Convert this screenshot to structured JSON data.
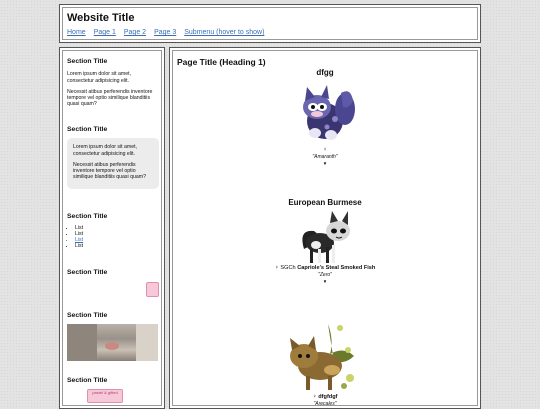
{
  "header": {
    "title": "Website Title",
    "nav": [
      "Home",
      "Page 1",
      "Page 2",
      "Page 3",
      "Submenu (hover to show)"
    ]
  },
  "sidebar": {
    "sections": [
      {
        "title": "Section Title",
        "p1": "Lorem ipsum dolor sit amet, consectetur adipisicing elit.",
        "p2": "Necessit atibus perferendis inventore tempore vel optio similique blanditiis quasi quam?"
      },
      {
        "title": "Section Title",
        "p1": "Lorem ipsum dolor sit amet, consectetur adipisicing elit.",
        "p2": "Necessit atibus perferendis inventore tempore vel optio similique blanditiis quasi quam?"
      },
      {
        "title": "Section Title",
        "list": [
          "List",
          "List",
          "List",
          "List"
        ]
      },
      {
        "title": "Section Title"
      },
      {
        "title": "Section Title"
      },
      {
        "title": "Section Title",
        "sticker": "pastel & gifted"
      }
    ]
  },
  "main": {
    "page_title": "Page Title (Heading 1)",
    "pets": [
      {
        "name": "dfgg",
        "gender": "♀",
        "prefix": "",
        "fullname": "",
        "nickname": "\"Amaranth\"",
        "toggle": "▼"
      },
      {
        "name": "European Burmese",
        "gender": "♀",
        "prefix": "SGCh",
        "fullname": "Capriole's Steal Smoked Fish",
        "nickname": "\"Zero\"",
        "toggle": "▼"
      },
      {
        "name": "",
        "gender": "♀",
        "prefix": "",
        "fullname": "dfgfdgf",
        "nickname": "\"Arecales\"",
        "toggle": "▼"
      }
    ]
  },
  "colors": {
    "link": "#3a6fb5",
    "border": "#555555",
    "background": "#e3e3e3"
  }
}
